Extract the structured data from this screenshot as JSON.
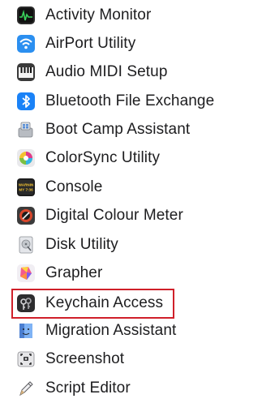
{
  "apps": [
    {
      "label": "Activity Monitor",
      "icon": "activity-monitor-icon"
    },
    {
      "label": "AirPort Utility",
      "icon": "airport-utility-icon"
    },
    {
      "label": "Audio MIDI Setup",
      "icon": "audio-midi-setup-icon"
    },
    {
      "label": "Bluetooth File Exchange",
      "icon": "bluetooth-icon"
    },
    {
      "label": "Boot Camp Assistant",
      "icon": "boot-camp-icon"
    },
    {
      "label": "ColorSync Utility",
      "icon": "colorsync-icon"
    },
    {
      "label": "Console",
      "icon": "console-icon"
    },
    {
      "label": "Digital Colour Meter",
      "icon": "colour-meter-icon"
    },
    {
      "label": "Disk Utility",
      "icon": "disk-utility-icon"
    },
    {
      "label": "Grapher",
      "icon": "grapher-icon"
    },
    {
      "label": "Keychain Access",
      "icon": "keychain-icon"
    },
    {
      "label": "Migration Assistant",
      "icon": "migration-assistant-icon"
    },
    {
      "label": "Screenshot",
      "icon": "screenshot-icon"
    },
    {
      "label": "Script Editor",
      "icon": "script-editor-icon"
    }
  ],
  "console_icon_text": "WARNIN MY 7:36",
  "highlight_color": "#d0202a"
}
